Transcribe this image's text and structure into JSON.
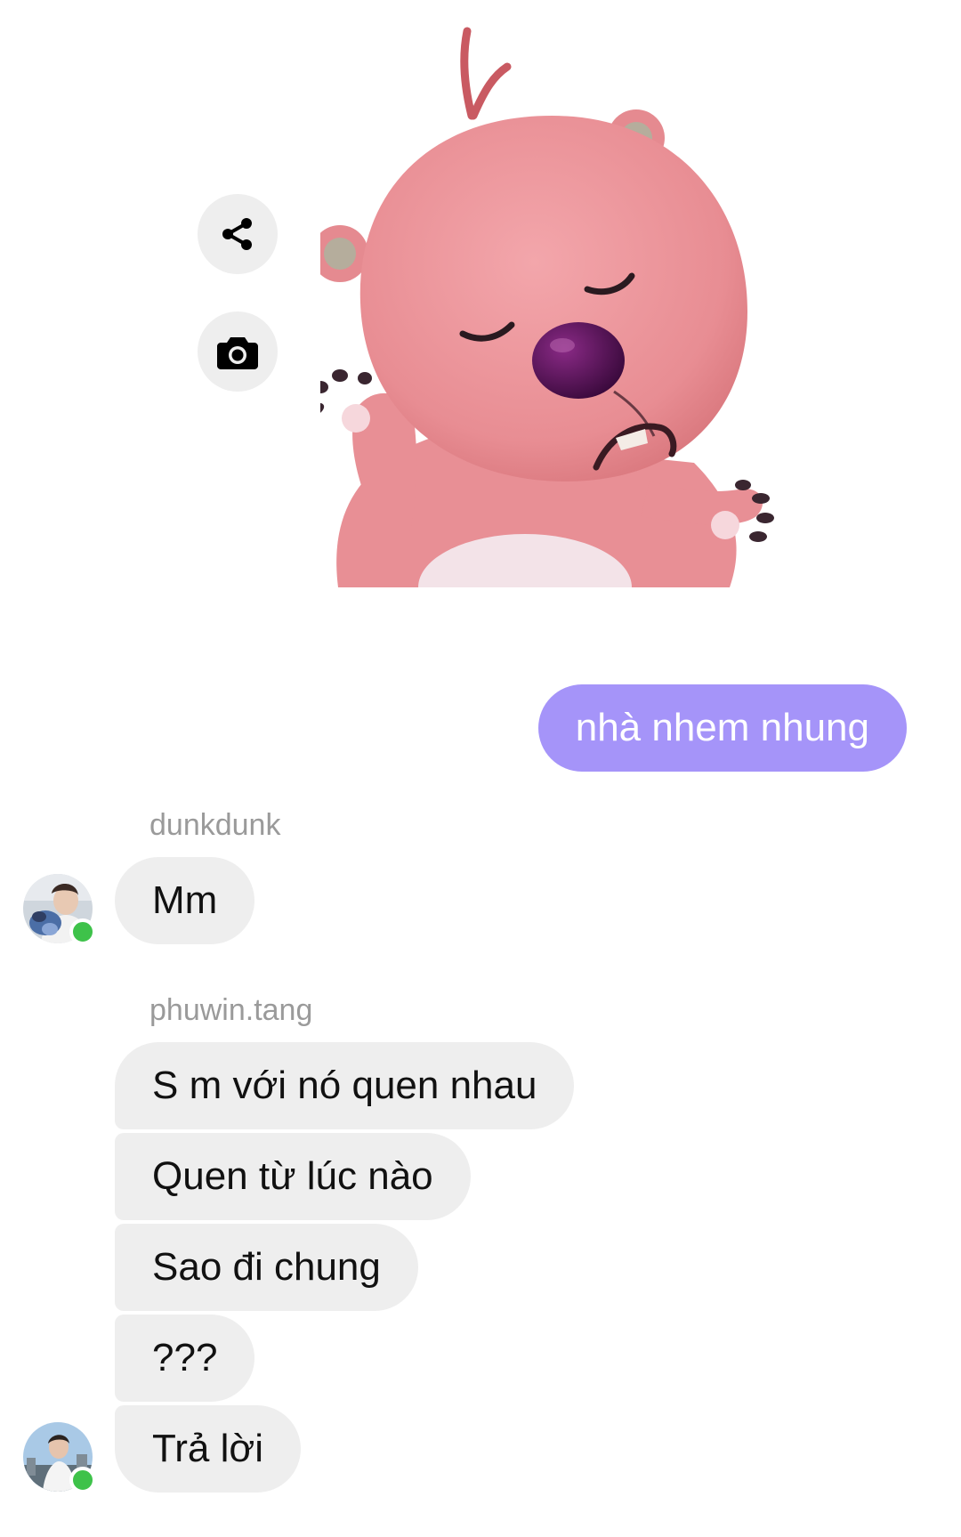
{
  "sticker": {
    "icon": "pink-beaver-crying-sticker"
  },
  "actions": {
    "share_icon": "share-icon",
    "camera_icon": "camera-icon"
  },
  "outgoing": {
    "message": "nhà nhem nhung",
    "color": "#a594f9"
  },
  "conversation": {
    "group1": {
      "sender": "dunkdunk",
      "messages": [
        "Mm"
      ]
    },
    "group2": {
      "sender": "phuwin.tang",
      "messages": [
        "S m với nó quen nhau",
        "Quen từ lúc nào",
        "Sao đi chung",
        "???",
        "Trả lời"
      ]
    }
  },
  "colors": {
    "incoming_bubble": "#eeeeee",
    "online": "#3ec24a",
    "sender_name": "#9a9a9a"
  }
}
